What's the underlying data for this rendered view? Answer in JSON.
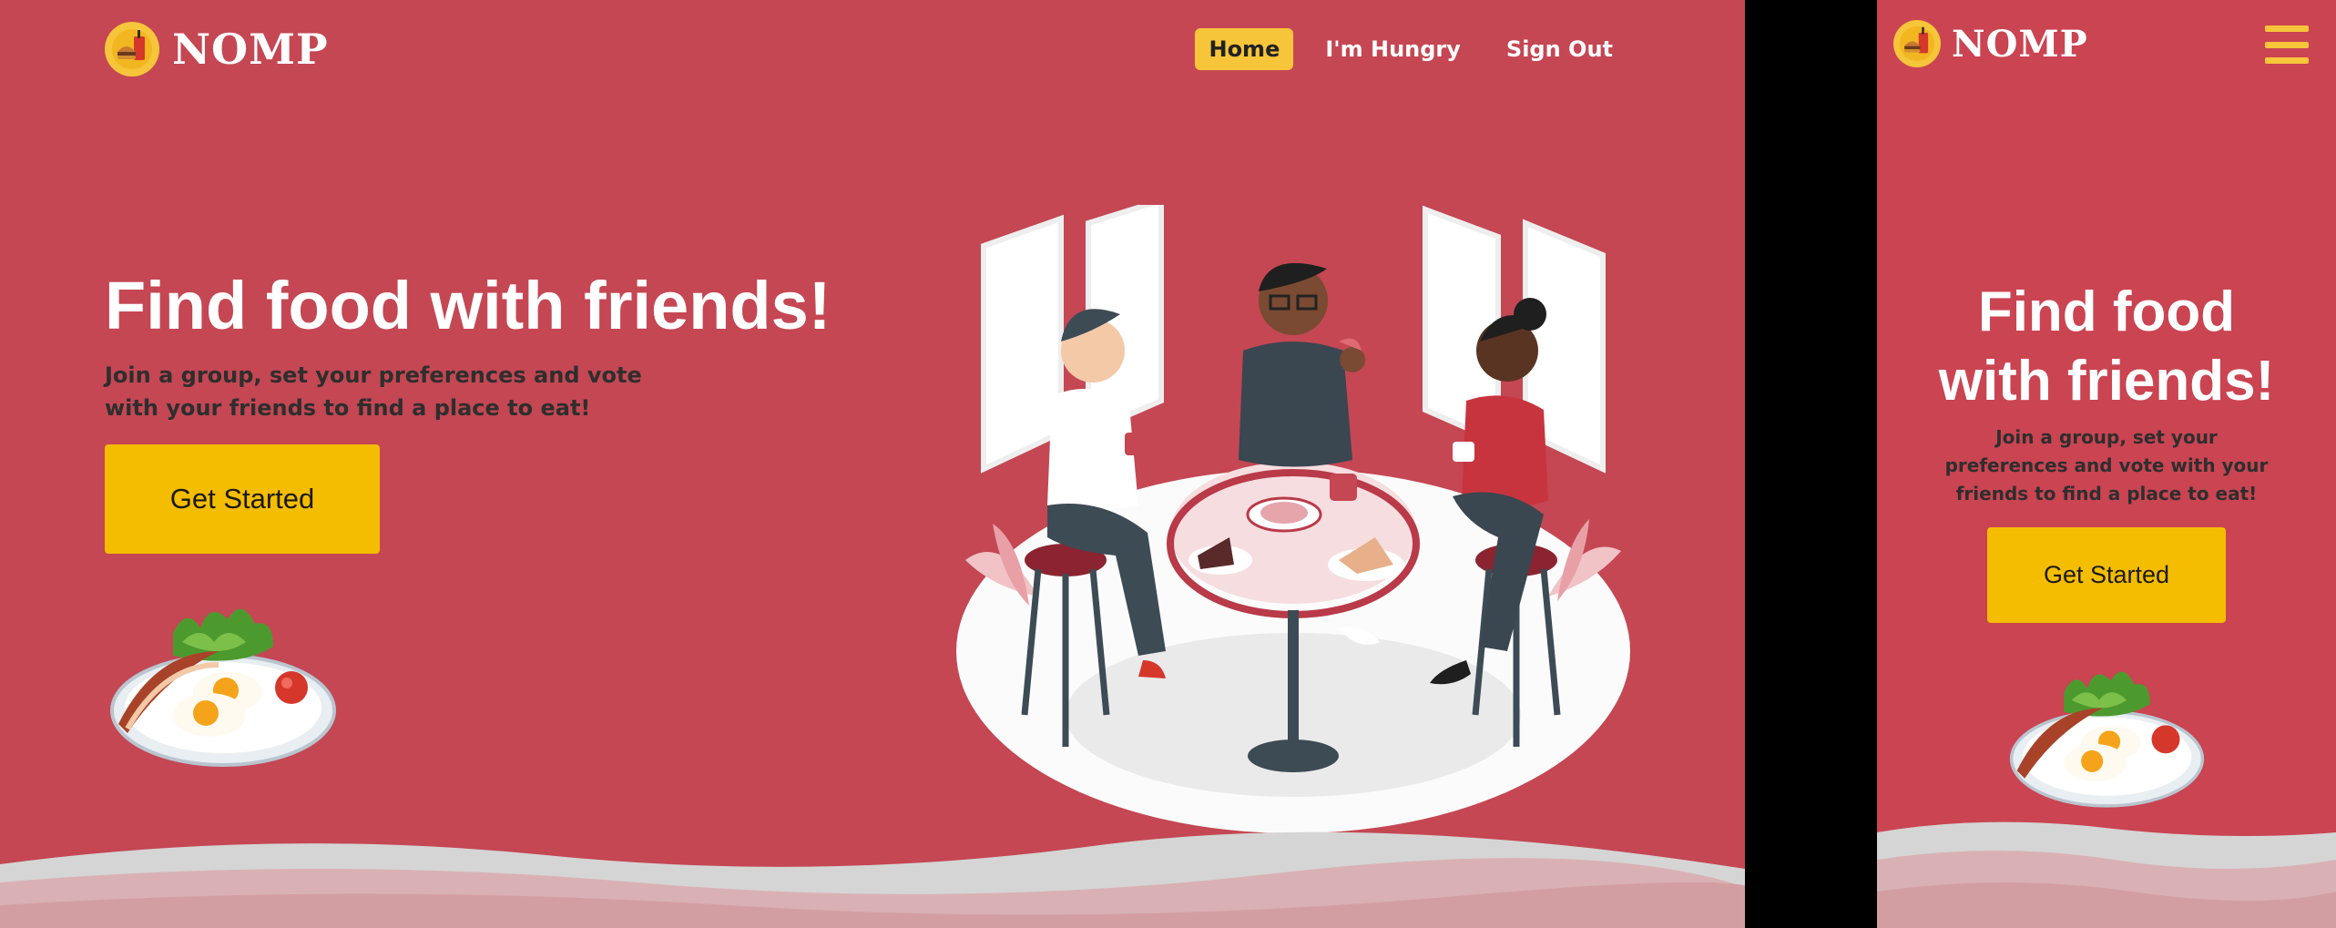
{
  "brand": {
    "name": "NOMP"
  },
  "nav": {
    "items": [
      {
        "label": "Home",
        "active": true
      },
      {
        "label": "I'm Hungry",
        "active": false
      },
      {
        "label": "Sign Out",
        "active": false
      }
    ]
  },
  "hero": {
    "title": "Find food with friends!",
    "mobile_title_line1": "Find food",
    "mobile_title_line2": "with friends!",
    "subtitle_line1": "Join a group, set your preferences and vote",
    "subtitle_line2": "with your friends to find a place to eat!",
    "mobile_sub_line1": "Join a group, set your",
    "mobile_sub_line2": "preferences and vote with your",
    "mobile_sub_line3": "friends to find a place to eat!",
    "cta_label": "Get Started"
  },
  "colors": {
    "background": "#c44753",
    "accent": "#f6c53a",
    "cta": "#f5bd00"
  },
  "icons": {
    "logo": "burger-drink-icon",
    "menu": "hamburger-menu-icon",
    "plate": "breakfast-plate-illustration",
    "scene": "friends-cafe-illustration"
  }
}
